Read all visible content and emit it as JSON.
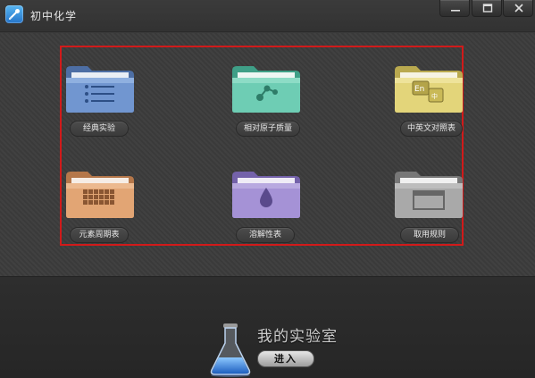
{
  "app": {
    "title": "初中化学"
  },
  "window_controls": {
    "minimize": "minimize",
    "maximize": "maximize",
    "close": "close"
  },
  "colors": {
    "highlight": "#d11a1a",
    "background": "#3c3c3c"
  },
  "tiles": [
    {
      "label": "经典实验",
      "icon": "list-icon",
      "folder_color": "#6f94cf"
    },
    {
      "label": "相对原子质量",
      "icon": "molecule-icon",
      "folder_color": "#6ecdb4"
    },
    {
      "label": "中英文对照表",
      "icon": "translate-icon",
      "folder_color": "#e3d57a"
    },
    {
      "label": "元素周期表",
      "icon": "periodic-table-icon",
      "folder_color": "#e2a574"
    },
    {
      "label": "溶解性表",
      "icon": "drop-icon",
      "folder_color": "#a592d6"
    },
    {
      "label": "取用规则",
      "icon": "window-icon",
      "folder_color": "#a9a9a9"
    }
  ],
  "lab": {
    "title": "我的实验室",
    "enter_label": "进入",
    "icon": "flask-icon"
  }
}
